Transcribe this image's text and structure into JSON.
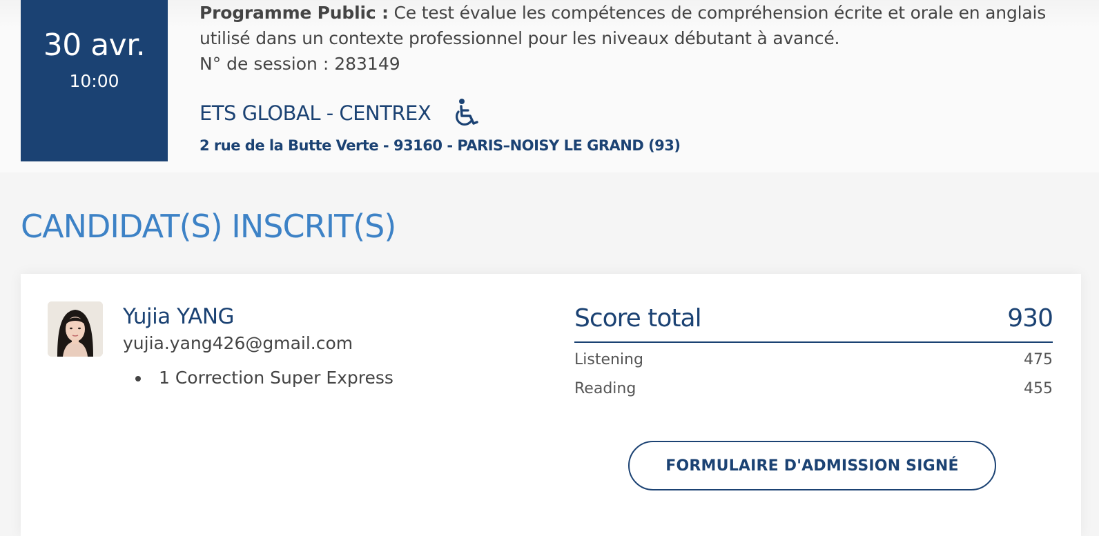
{
  "session": {
    "date_day": "30 avr.",
    "date_time": "10:00",
    "program_label": "Programme Public :",
    "program_description": " Ce test évalue les compétences de compréhension écrite et orale en anglais utilisé dans un contexte professionnel pour les niveaux débutant à avancé.",
    "session_number": "N° de session : 283149",
    "center_name": "ETS GLOBAL - CENTREX",
    "accessibility_icon": "wheelchair-icon",
    "center_address": "2 rue de la Butte Verte - 93160 - PARIS–NOISY LE GRAND (93)"
  },
  "candidates_section": {
    "title": "CANDIDAT(S) INSCRIT(S)"
  },
  "candidate": {
    "name": "Yujia YANG",
    "email": "yujia.yang426@gmail.com",
    "options": [
      "1 Correction Super Express"
    ],
    "score": {
      "total_label": "Score total",
      "total_value": "930",
      "rows": [
        {
          "label": "Listening",
          "value": "475"
        },
        {
          "label": "Reading",
          "value": "455"
        }
      ]
    },
    "admission_button": "FORMULAIRE D'ADMISSION SIGNÉ"
  },
  "colors": {
    "brand_navy": "#1b4273",
    "section_blue": "#3d82c6",
    "text_gray": "#444444"
  }
}
